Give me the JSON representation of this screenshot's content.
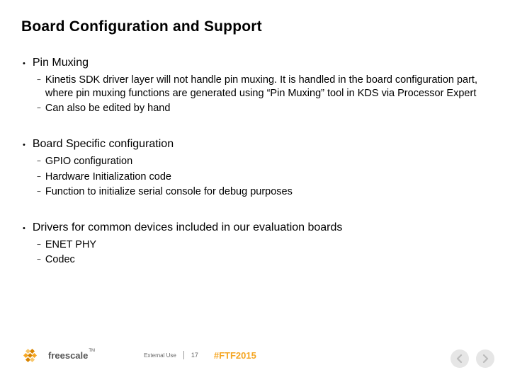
{
  "title": "Board Configuration and Support",
  "items": [
    {
      "title": "Pin Muxing",
      "subs": [
        "Kinetis SDK driver layer will not handle pin muxing. It is handled in the board configuration part, where pin muxing functions are generated using “Pin Muxing” tool in KDS via Processor Expert",
        "Can also be edited by hand"
      ]
    },
    {
      "title": "Board Specific configuration",
      "subs": [
        "GPIO configuration",
        "Hardware Initialization code",
        "Function to initialize serial console for debug purposes"
      ]
    },
    {
      "title": "Drivers for common devices included in our evaluation boards",
      "subs": [
        "ENET PHY",
        "Codec"
      ]
    }
  ],
  "footer": {
    "brand": "freescale",
    "external_use": "External Use",
    "page_number": "17",
    "hashtag": "#FTF2015"
  }
}
